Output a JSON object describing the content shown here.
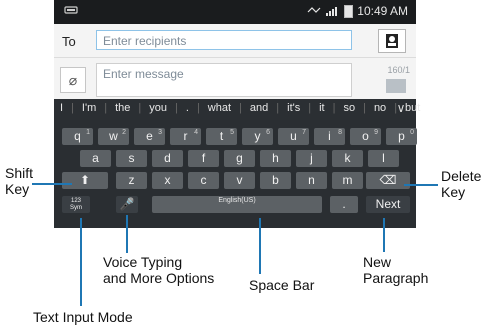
{
  "status": {
    "time": "10:49 AM"
  },
  "compose": {
    "to_label": "To",
    "recipients_placeholder": "Enter recipients",
    "message_placeholder": "Enter message",
    "char_count": "160/1"
  },
  "predictions": {
    "words": [
      "I",
      "I'm",
      "the",
      "you",
      ".",
      "what",
      "and",
      "it's",
      "it",
      "so",
      "no",
      "but"
    ]
  },
  "keyboard": {
    "row1": [
      {
        "label": "q",
        "sub": "1"
      },
      {
        "label": "w",
        "sub": "2"
      },
      {
        "label": "e",
        "sub": "3"
      },
      {
        "label": "r",
        "sub": "4"
      },
      {
        "label": "t",
        "sub": "5"
      },
      {
        "label": "y",
        "sub": "6"
      },
      {
        "label": "u",
        "sub": "7"
      },
      {
        "label": "i",
        "sub": "8"
      },
      {
        "label": "o",
        "sub": "9"
      },
      {
        "label": "p",
        "sub": "0"
      }
    ],
    "row2": [
      "a",
      "s",
      "d",
      "f",
      "g",
      "h",
      "j",
      "k",
      "l"
    ],
    "row3": [
      "z",
      "x",
      "c",
      "v",
      "b",
      "n",
      "m"
    ],
    "mode_key": "123\nSym",
    "space_label": "English(US)",
    "period_key": ".",
    "next_key": "Next"
  },
  "callouts": {
    "shift": "Shift\nKey",
    "delete": "Delete\nKey",
    "voice": "Voice Typing\nand More Options",
    "space": "Space Bar",
    "new_paragraph": "New\nParagraph",
    "text_input": "Text Input Mode"
  },
  "colors": {
    "callout_line": "#1f77b4"
  }
}
